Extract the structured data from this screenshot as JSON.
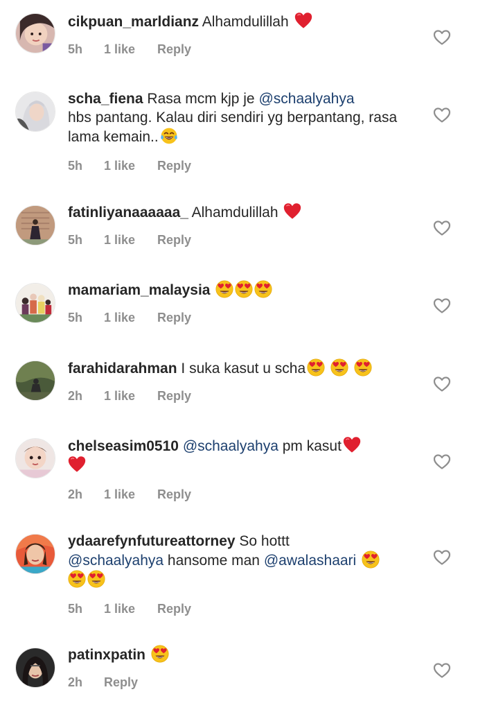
{
  "comments": [
    {
      "username": "cikpuan_marldianz",
      "text": "Alhamdulillah",
      "time": "5h",
      "likes": "1 like",
      "reply": "Reply"
    },
    {
      "username": "scha_fiena",
      "text_pre": "Rasa mcm kjp je",
      "mention": "@schaalyahya",
      "text_post": "hbs pantang. Kalau diri sendiri yg berpantang, rasa lama kemain..",
      "time": "5h",
      "likes": "1 like",
      "reply": "Reply"
    },
    {
      "username": "fatinliyanaaaaaa_",
      "text": "Alhamdulillah",
      "time": "5h",
      "likes": "1 like",
      "reply": "Reply"
    },
    {
      "username": "mamariam_malaysia",
      "text": "",
      "time": "5h",
      "likes": "1 like",
      "reply": "Reply"
    },
    {
      "username": "farahidarahman",
      "text": "I suka kasut u scha",
      "time": "2h",
      "likes": "1 like",
      "reply": "Reply"
    },
    {
      "username": "chelseasim0510",
      "mention": "@schaalyahya",
      "text": "pm kasut",
      "time": "2h",
      "likes": "1 like",
      "reply": "Reply"
    },
    {
      "username": "ydaarefynfutureattorney",
      "text_pre": "So hottt",
      "mention": "@schaalyahya",
      "text_mid": "hansome man",
      "mention2": "@awalashaari",
      "time": "5h",
      "likes": "1 like",
      "reply": "Reply"
    },
    {
      "username": "patinxpatin",
      "text": "",
      "time": "2h",
      "reply": "Reply"
    }
  ],
  "icons": {
    "like": "heart-outline-icon",
    "red_heart": "red-heart-emoji",
    "heart_eyes": "heart-eyes-emoji",
    "tears_of_joy": "tears-of-joy-emoji"
  },
  "colors": {
    "username": "#262626",
    "meta": "#8e8e8e",
    "mention": "#1c3f6e",
    "heart_red": "#e0202f"
  }
}
